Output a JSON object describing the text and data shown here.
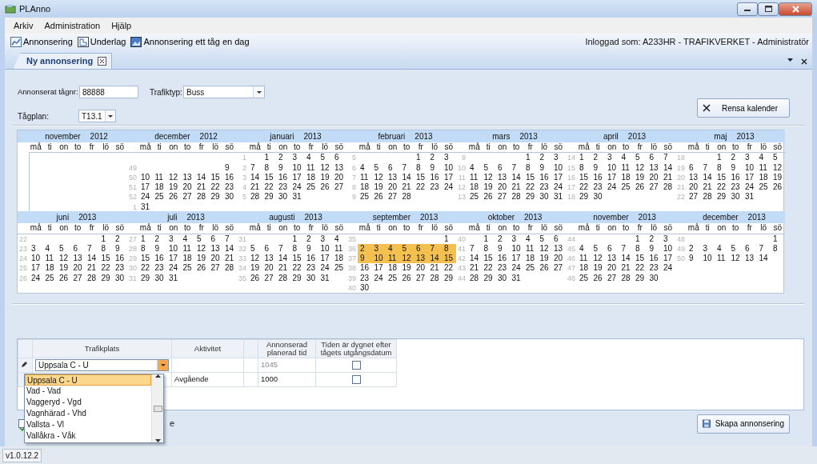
{
  "window": {
    "title": "PLAnno"
  },
  "menu": [
    "Arkiv",
    "Administration",
    "Hjälp"
  ],
  "toolbar": {
    "items": [
      {
        "label": "Annonsering",
        "kind": "chart"
      },
      {
        "label": "Underlag",
        "kind": "doc"
      },
      {
        "label": "Annonsering ett tåg en dag",
        "kind": "image"
      }
    ],
    "login": "Inloggad som: A233HR - TRAFIKVERKET - Administratör"
  },
  "tabs": [
    {
      "label": "Ny annonsering",
      "selected": true
    }
  ],
  "form": {
    "train_number": {
      "label": "Annonserat tågnr:",
      "value": "88888"
    },
    "traffic_type": {
      "label": "Trafiktyp:",
      "value": "Buss"
    },
    "timetable": {
      "label": "Tågplan:",
      "value": "T13.1"
    }
  },
  "clear_button": "Rensa kalender",
  "months": [
    {
      "month": "november",
      "year": "2012",
      "weekdays": [
        "må",
        "ti",
        "on",
        "to",
        "fr",
        "lö",
        "sö"
      ]
    },
    {
      "month": "december",
      "year": "2012",
      "weekdays": [
        "må",
        "ti",
        "on",
        "to",
        "fr",
        "lö",
        "sö"
      ],
      "weeks": [
        {
          "kind": "blank",
          "selected": false
        },
        {
          "kind": "start",
          "week": "49",
          "selected": false,
          "days": [
            "9"
          ]
        },
        {
          "kind": "full",
          "week": "50",
          "selected": false,
          "days": [
            "10",
            "11",
            "12",
            "13",
            "14",
            "15",
            "16"
          ]
        },
        {
          "kind": "full",
          "week": "51",
          "selected": false,
          "days": [
            "17",
            "18",
            "19",
            "20",
            "21",
            "22",
            "23"
          ]
        },
        {
          "kind": "full",
          "week": "52",
          "selected": false,
          "days": [
            "24",
            "25",
            "26",
            "27",
            "28",
            "29",
            "30"
          ]
        },
        {
          "kind": "end",
          "week": "1",
          "selected": false,
          "days": [
            "31"
          ]
        }
      ]
    },
    {
      "month": "januari",
      "year": "2013",
      "weekdays": [
        "må",
        "ti",
        "on",
        "to",
        "fr",
        "lö",
        "sö"
      ],
      "weeks": [
        {
          "kind": "start",
          "week": "1",
          "selected": false,
          "days": [
            "1",
            "2",
            "3",
            "4",
            "5",
            "6"
          ]
        },
        {
          "kind": "full",
          "week": "2",
          "selected": false,
          "days": [
            "7",
            "8",
            "9",
            "10",
            "11",
            "12",
            "13"
          ]
        },
        {
          "kind": "full",
          "week": "3",
          "selected": false,
          "days": [
            "14",
            "15",
            "16",
            "17",
            "18",
            "19",
            "20"
          ]
        },
        {
          "kind": "full",
          "week": "4",
          "selected": false,
          "days": [
            "21",
            "22",
            "23",
            "24",
            "25",
            "26",
            "27"
          ]
        },
        {
          "kind": "end",
          "week": "5",
          "selected": false,
          "days": [
            "28",
            "29",
            "30",
            "31"
          ]
        }
      ]
    },
    {
      "month": "februari",
      "year": "2013",
      "weekdays": [
        "må",
        "ti",
        "on",
        "to",
        "fr",
        "lö",
        "sö"
      ],
      "weeks": [
        {
          "kind": "start",
          "week": "5",
          "selected": false,
          "days": [
            "1",
            "2",
            "3"
          ]
        },
        {
          "kind": "full",
          "week": "6",
          "selected": false,
          "days": [
            "4",
            "5",
            "6",
            "7",
            "8",
            "9",
            "10"
          ]
        },
        {
          "kind": "full",
          "week": "7",
          "selected": false,
          "days": [
            "11",
            "12",
            "13",
            "14",
            "15",
            "16",
            "17"
          ]
        },
        {
          "kind": "full",
          "week": "8",
          "selected": false,
          "days": [
            "18",
            "19",
            "20",
            "21",
            "22",
            "23",
            "24"
          ]
        },
        {
          "kind": "end",
          "week": "9",
          "selected": false,
          "days": [
            "25",
            "26",
            "27",
            "28"
          ]
        }
      ]
    },
    {
      "month": "mars",
      "year": "2013",
      "weekdays": [
        "må",
        "ti",
        "on",
        "to",
        "fr",
        "lö",
        "sö"
      ],
      "weeks": [
        {
          "kind": "start",
          "week": "9",
          "selected": false,
          "days": [
            "1",
            "2",
            "3"
          ]
        },
        {
          "kind": "full",
          "week": "10",
          "selected": false,
          "days": [
            "4",
            "5",
            "6",
            "7",
            "8",
            "9",
            "10"
          ]
        },
        {
          "kind": "full",
          "week": "11",
          "selected": false,
          "days": [
            "11",
            "12",
            "13",
            "14",
            "15",
            "16",
            "17"
          ]
        },
        {
          "kind": "full",
          "week": "12",
          "selected": false,
          "days": [
            "18",
            "19",
            "20",
            "21",
            "22",
            "23",
            "24"
          ]
        },
        {
          "kind": "full",
          "week": "13",
          "selected": false,
          "days": [
            "25",
            "26",
            "27",
            "28",
            "29",
            "30",
            "31"
          ]
        }
      ]
    },
    {
      "month": "april",
      "year": "2013",
      "weekdays": [
        "må",
        "ti",
        "on",
        "to",
        "fr",
        "lö",
        "sö"
      ],
      "weeks": [
        {
          "kind": "full",
          "week": "14",
          "selected": false,
          "days": [
            "1",
            "2",
            "3",
            "4",
            "5",
            "6",
            "7"
          ]
        },
        {
          "kind": "full",
          "week": "15",
          "selected": false,
          "days": [
            "8",
            "9",
            "10",
            "11",
            "12",
            "13",
            "14"
          ]
        },
        {
          "kind": "full",
          "week": "16",
          "selected": false,
          "days": [
            "15",
            "16",
            "17",
            "18",
            "19",
            "20",
            "21"
          ]
        },
        {
          "kind": "full",
          "week": "17",
          "selected": false,
          "days": [
            "22",
            "23",
            "24",
            "25",
            "26",
            "27",
            "28"
          ]
        },
        {
          "kind": "end",
          "week": "18",
          "selected": false,
          "days": [
            "29",
            "30"
          ]
        }
      ]
    },
    {
      "month": "maj",
      "year": "2013",
      "weekdays": [
        "må",
        "ti",
        "on",
        "to",
        "fr",
        "lö",
        "sö"
      ],
      "weeks": [
        {
          "kind": "start",
          "week": "18",
          "selected": false,
          "days": [
            "1",
            "2",
            "3",
            "4",
            "5"
          ]
        },
        {
          "kind": "full",
          "week": "19",
          "selected": false,
          "days": [
            "6",
            "7",
            "8",
            "9",
            "10",
            "11",
            "12"
          ]
        },
        {
          "kind": "full",
          "week": "20",
          "selected": false,
          "days": [
            "13",
            "14",
            "15",
            "16",
            "17",
            "18",
            "19"
          ]
        },
        {
          "kind": "full",
          "week": "21",
          "selected": false,
          "days": [
            "20",
            "21",
            "22",
            "23",
            "24",
            "25",
            "26"
          ]
        },
        {
          "kind": "end",
          "week": "22",
          "selected": false,
          "days": [
            "27",
            "28",
            "29",
            "30",
            "31"
          ]
        }
      ]
    },
    {
      "month": "juni",
      "year": "2013",
      "weekdays": [
        "må",
        "ti",
        "on",
        "to",
        "fr",
        "lö",
        "sö"
      ],
      "weeks": [
        {
          "kind": "start",
          "week": "22",
          "selected": false,
          "days": [
            "1",
            "2"
          ]
        },
        {
          "kind": "full",
          "week": "23",
          "selected": false,
          "days": [
            "3",
            "4",
            "5",
            "6",
            "7",
            "8",
            "9"
          ]
        },
        {
          "kind": "full",
          "week": "24",
          "selected": false,
          "days": [
            "10",
            "11",
            "12",
            "13",
            "14",
            "15",
            "16"
          ]
        },
        {
          "kind": "full",
          "week": "25",
          "selected": false,
          "days": [
            "17",
            "18",
            "19",
            "20",
            "21",
            "22",
            "23"
          ]
        },
        {
          "kind": "full",
          "week": "26",
          "selected": false,
          "days": [
            "24",
            "25",
            "26",
            "27",
            "28",
            "29",
            "30"
          ]
        }
      ]
    },
    {
      "month": "juli",
      "year": "2013",
      "weekdays": [
        "må",
        "ti",
        "on",
        "to",
        "fr",
        "lö",
        "sö"
      ],
      "weeks": [
        {
          "kind": "full",
          "week": "27",
          "selected": false,
          "days": [
            "1",
            "2",
            "3",
            "4",
            "5",
            "6",
            "7"
          ]
        },
        {
          "kind": "full",
          "week": "28",
          "selected": false,
          "days": [
            "8",
            "9",
            "10",
            "11",
            "12",
            "13",
            "14"
          ]
        },
        {
          "kind": "full",
          "week": "29",
          "selected": false,
          "days": [
            "15",
            "16",
            "17",
            "18",
            "19",
            "20",
            "21"
          ]
        },
        {
          "kind": "full",
          "week": "30",
          "selected": false,
          "days": [
            "22",
            "23",
            "24",
            "25",
            "26",
            "27",
            "28"
          ]
        },
        {
          "kind": "end",
          "week": "31",
          "selected": false,
          "days": [
            "29",
            "30",
            "31"
          ]
        }
      ]
    },
    {
      "month": "augusti",
      "year": "2013",
      "weekdays": [
        "må",
        "ti",
        "on",
        "to",
        "fr",
        "lö",
        "sö"
      ],
      "weeks": [
        {
          "kind": "start",
          "week": "31",
          "selected": false,
          "days": [
            "1",
            "2",
            "3",
            "4"
          ]
        },
        {
          "kind": "full",
          "week": "32",
          "selected": false,
          "days": [
            "5",
            "6",
            "7",
            "8",
            "9",
            "10",
            "11"
          ]
        },
        {
          "kind": "full",
          "week": "33",
          "selected": false,
          "days": [
            "12",
            "13",
            "14",
            "15",
            "16",
            "17",
            "18"
          ]
        },
        {
          "kind": "full",
          "week": "34",
          "selected": false,
          "days": [
            "19",
            "20",
            "21",
            "22",
            "23",
            "24",
            "25"
          ]
        },
        {
          "kind": "end",
          "week": "35",
          "selected": false,
          "days": [
            "26",
            "27",
            "28",
            "29",
            "30",
            "31"
          ]
        }
      ]
    },
    {
      "month": "september",
      "year": "2013",
      "weekdays": [
        "må",
        "ti",
        "on",
        "to",
        "fr",
        "lö",
        "sö"
      ],
      "weeks": [
        {
          "kind": "start",
          "week": "35",
          "selected": false,
          "days": [
            "1"
          ]
        },
        {
          "kind": "full",
          "week": "36",
          "selected": true,
          "days": [
            "2",
            "3",
            "4",
            "5",
            "6",
            "7",
            "8"
          ]
        },
        {
          "kind": "full",
          "week": "37",
          "selected": true,
          "days": [
            "9",
            "10",
            "11",
            "12",
            "13",
            "14",
            "15"
          ]
        },
        {
          "kind": "full",
          "week": "38",
          "selected": false,
          "days": [
            "16",
            "17",
            "18",
            "19",
            "20",
            "21",
            "22"
          ]
        },
        {
          "kind": "full",
          "week": "39",
          "selected": false,
          "days": [
            "23",
            "24",
            "25",
            "26",
            "27",
            "28",
            "29"
          ]
        },
        {
          "kind": "end",
          "week": "40",
          "selected": false,
          "days": [
            "30"
          ]
        }
      ]
    },
    {
      "month": "oktober",
      "year": "2013",
      "weekdays": [
        "må",
        "ti",
        "on",
        "to",
        "fr",
        "lö",
        "sö"
      ],
      "weeks": [
        {
          "kind": "start",
          "week": "40",
          "selected": false,
          "days": [
            "1",
            "2",
            "3",
            "4",
            "5",
            "6"
          ]
        },
        {
          "kind": "full",
          "week": "41",
          "selected": false,
          "days": [
            "7",
            "8",
            "9",
            "10",
            "11",
            "12",
            "13"
          ]
        },
        {
          "kind": "full",
          "week": "42",
          "selected": false,
          "days": [
            "14",
            "15",
            "16",
            "17",
            "18",
            "19",
            "20"
          ]
        },
        {
          "kind": "full",
          "week": "43",
          "selected": false,
          "days": [
            "21",
            "22",
            "23",
            "24",
            "25",
            "26",
            "27"
          ]
        },
        {
          "kind": "end",
          "week": "44",
          "selected": false,
          "days": [
            "28",
            "29",
            "30",
            "31"
          ]
        }
      ]
    },
    {
      "month": "november",
      "year": "2013",
      "weekdays": [
        "må",
        "ti",
        "on",
        "to",
        "fr",
        "lö",
        "sö"
      ],
      "weeks": [
        {
          "kind": "start",
          "week": "44",
          "selected": false,
          "days": [
            "1",
            "2",
            "3"
          ]
        },
        {
          "kind": "full",
          "week": "45",
          "selected": false,
          "days": [
            "4",
            "5",
            "6",
            "7",
            "8",
            "9",
            "10"
          ]
        },
        {
          "kind": "full",
          "week": "46",
          "selected": false,
          "days": [
            "11",
            "12",
            "13",
            "14",
            "15",
            "16",
            "17"
          ]
        },
        {
          "kind": "full",
          "week": "47",
          "selected": false,
          "days": [
            "18",
            "19",
            "20",
            "21",
            "22",
            "23",
            "24"
          ]
        },
        {
          "kind": "end",
          "week": "48",
          "selected": false,
          "days": [
            "25",
            "26",
            "27",
            "28",
            "29",
            "30"
          ]
        }
      ]
    },
    {
      "month": "december",
      "year": "2013",
      "weekdays": [
        "må",
        "ti",
        "on",
        "to",
        "fr",
        "lö",
        "sö"
      ],
      "weeks": [
        {
          "kind": "start",
          "week": "48",
          "selected": false,
          "days": [
            "1"
          ]
        },
        {
          "kind": "full",
          "week": "49",
          "selected": false,
          "days": [
            "2",
            "3",
            "4",
            "5",
            "6",
            "7",
            "8"
          ]
        },
        {
          "kind": "end",
          "week": "50",
          "selected": false,
          "days": [
            "9",
            "10",
            "11",
            "12",
            "13",
            "14"
          ]
        }
      ]
    }
  ],
  "grid": {
    "columns": [
      "Trafikplats",
      "Aktivitet",
      "Annonserad planerad tid",
      "Tiden är dygnet efter tågets utgångsdatum"
    ],
    "rows": [
      {
        "editing": true,
        "trafikplats": "Uppsala C - U",
        "time": "1045",
        "next_day": false
      },
      {
        "editing": false,
        "aktivitet": "Avgående",
        "time": "1000",
        "next_day": false
      }
    ]
  },
  "dropdown": {
    "items": [
      {
        "label": "Uppsala C - U",
        "selected": true
      },
      {
        "label": "Vad - Vad",
        "selected": false
      },
      {
        "label": "Vaggeryd - Vgd",
        "selected": false
      },
      {
        "label": "Vagnhärad - Vhd",
        "selected": false
      },
      {
        "label": "Vallsta - Vl",
        "selected": false
      },
      {
        "label": "Vallåkra - Våk",
        "selected": false
      }
    ]
  },
  "option_checkbox": {
    "checked": true,
    "label": "e"
  },
  "create_button": "Skapa annonsering",
  "status_bar": {
    "version": "v1.0.12.2"
  }
}
